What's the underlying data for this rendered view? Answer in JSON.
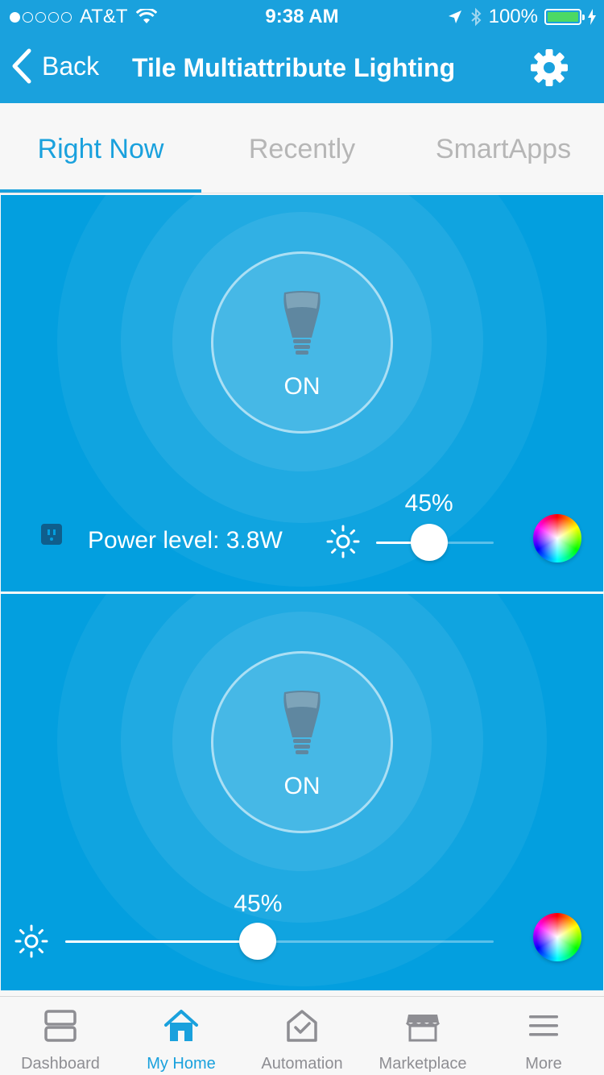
{
  "status_bar": {
    "carrier": "AT&T",
    "time": "9:38 AM",
    "battery_percent": "100%",
    "signal_bars": 1
  },
  "nav": {
    "back_label": "Back",
    "title": "Tile Multiattribute Lighting",
    "settings_icon": "gear-icon"
  },
  "tabs": [
    {
      "label": "Right Now",
      "active": true
    },
    {
      "label": "Recently",
      "active": false
    },
    {
      "label": "SmartApps",
      "active": false
    }
  ],
  "tiles": [
    {
      "state": "ON",
      "power_label": "Power level: 3.8W",
      "brightness_label": "45%",
      "brightness_value": 0.45
    },
    {
      "state": "ON",
      "brightness_label": "45%",
      "brightness_value": 0.45
    }
  ],
  "tabbar": [
    {
      "label": "Dashboard",
      "icon": "dashboard-icon",
      "active": false
    },
    {
      "label": "My Home",
      "icon": "home-icon",
      "active": true
    },
    {
      "label": "Automation",
      "icon": "automation-icon",
      "active": false
    },
    {
      "label": "Marketplace",
      "icon": "marketplace-icon",
      "active": false
    },
    {
      "label": "More",
      "icon": "more-icon",
      "active": false
    }
  ],
  "colors": {
    "accent": "#1aa1dd",
    "tile_bg": "#039fdf",
    "inactive": "#8e8e93"
  }
}
